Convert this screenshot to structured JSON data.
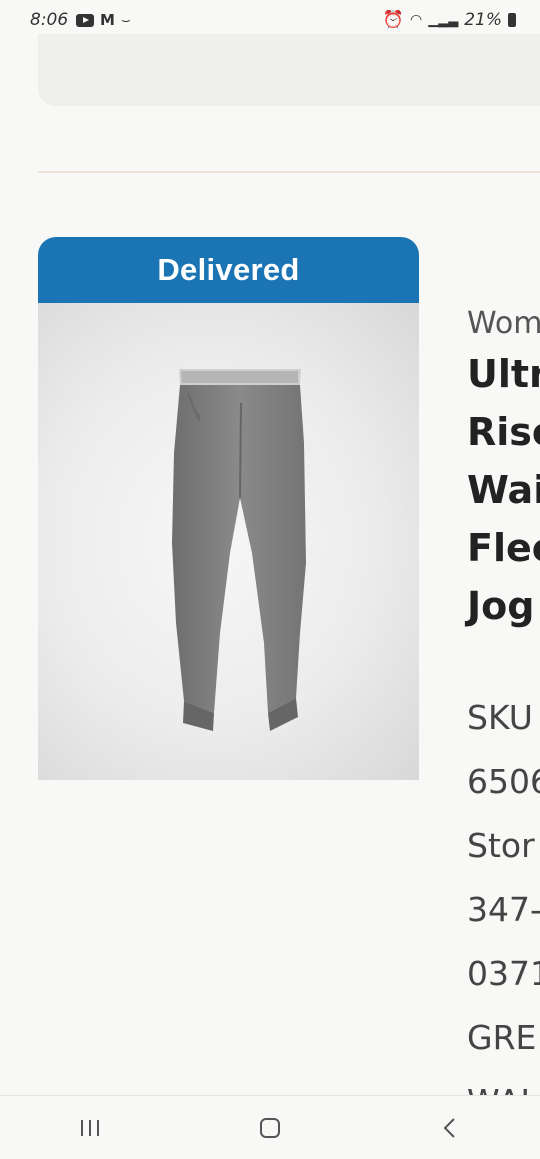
{
  "status_bar": {
    "time": "8:06",
    "battery_text": "21%",
    "icons": [
      "youtube-icon",
      "gmail-icon",
      "amazon-icon",
      "alarm-icon",
      "wifi-icon",
      "signal-icon",
      "battery-icon"
    ]
  },
  "order_item": {
    "status_badge": "Delivered",
    "badge_color": "#1b75b5",
    "category": "Wom",
    "title_lines": [
      "Ultr",
      "Rise",
      "Wai",
      "Flee",
      "Jog"
    ],
    "details": [
      "SKU",
      "6506",
      "Stor",
      "347-",
      "0371",
      "GRE",
      "WAI"
    ]
  },
  "nav_bar": {
    "buttons": [
      "recent-apps-icon",
      "home-icon",
      "back-icon"
    ]
  }
}
